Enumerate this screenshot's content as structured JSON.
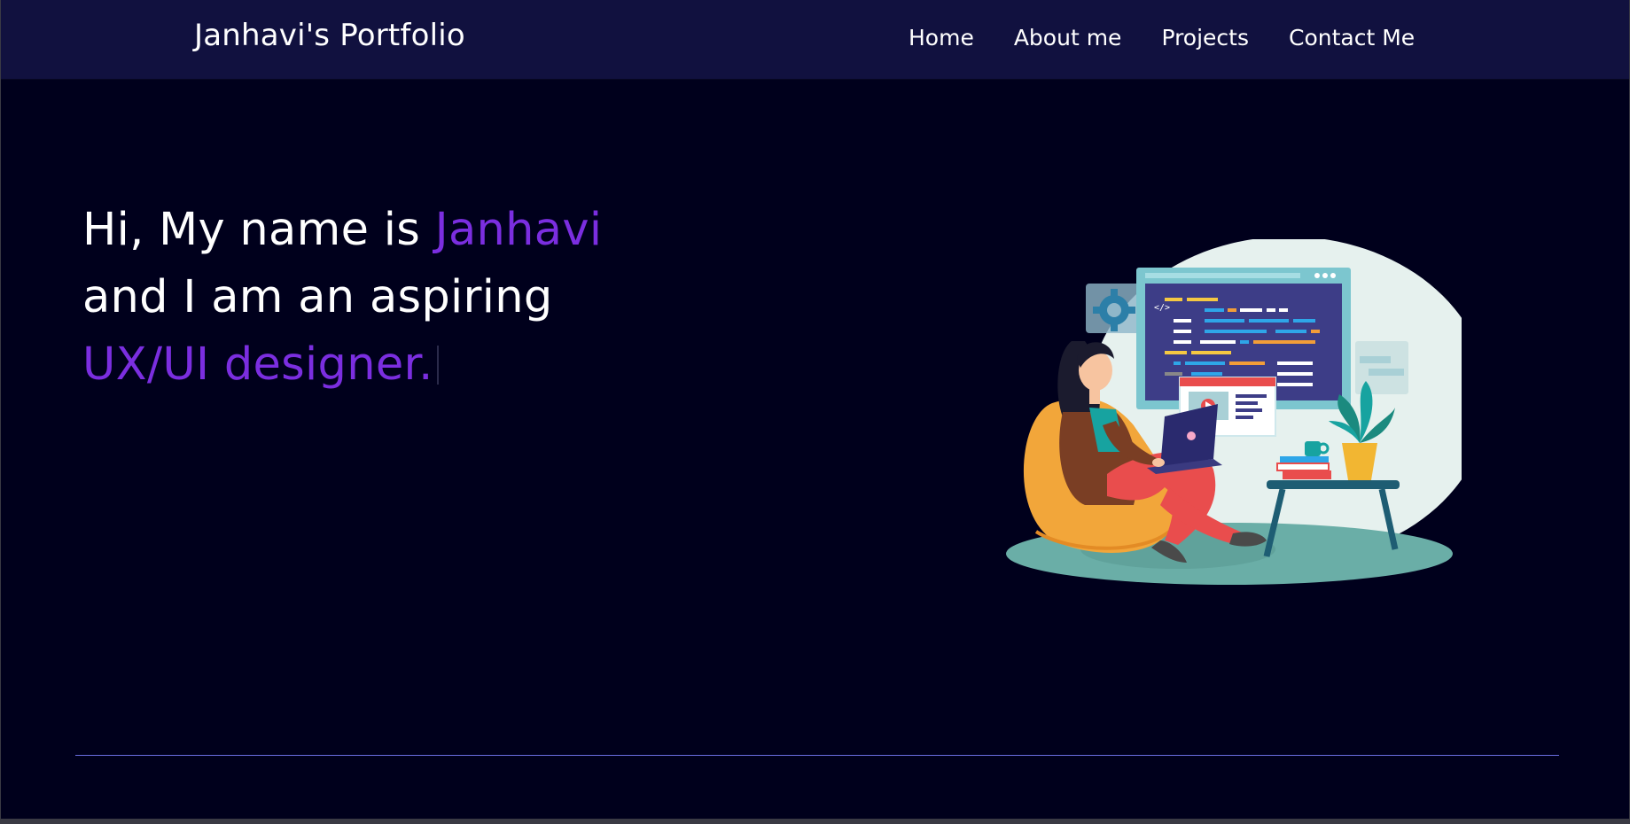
{
  "navbar": {
    "brand": "Janhavi's Portfolio",
    "links": [
      "Home",
      "About me",
      "Projects",
      "Contact Me"
    ]
  },
  "hero": {
    "line1_prefix": "Hi, My name is ",
    "line1_name": "Janhavi",
    "line2": "and I am an aspiring",
    "line3": "UX/UI designer."
  },
  "illustration": {
    "code_tag": "</>"
  },
  "colors": {
    "background": "#00001c",
    "navbar": "#11113f",
    "accent": "#7b2ee0",
    "divider": "#6a6ee0"
  },
  "icons": [
    "gear-icon",
    "play-icon"
  ]
}
